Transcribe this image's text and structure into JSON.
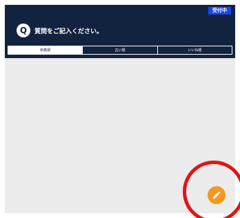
{
  "header": {
    "status_badge": "受付中",
    "q_icon": "Q",
    "question": "質問をご記入ください。"
  },
  "tabs": [
    {
      "label": "新着順",
      "active": true
    },
    {
      "label": "古い順",
      "active": false
    },
    {
      "label": "いいね順",
      "active": false
    }
  ],
  "fab": {
    "icon": "pencil-icon"
  },
  "colors": {
    "header_bg": "#12233f",
    "badge_bg": "#1a45f0",
    "content_bg": "#ececec",
    "fab_bg": "#f39a1e",
    "highlight_ring": "#e11414"
  }
}
